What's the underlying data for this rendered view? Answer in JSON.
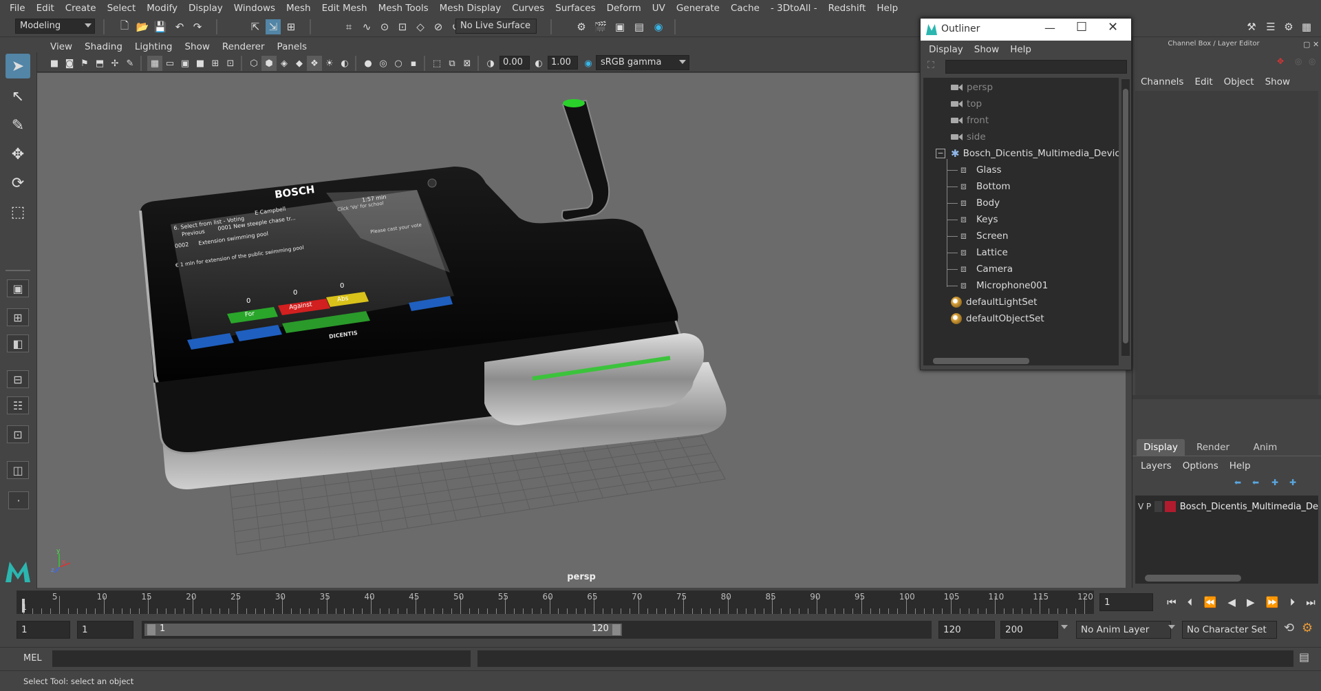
{
  "menubar": [
    "File",
    "Edit",
    "Create",
    "Select",
    "Modify",
    "Display",
    "Windows",
    "Mesh",
    "Edit Mesh",
    "Mesh Tools",
    "Mesh Display",
    "Curves",
    "Surfaces",
    "Deform",
    "UV",
    "Generate",
    "Cache",
    "- 3DtoAll -",
    "Redshift",
    "Help"
  ],
  "statusline": {
    "menuset": "Modeling",
    "live_surface": "No Live Surface"
  },
  "viewport": {
    "menus": [
      "View",
      "Shading",
      "Lighting",
      "Show",
      "Renderer",
      "Panels"
    ],
    "exposure": "0.00",
    "gamma": "1.00",
    "colorspace": "sRGB gamma",
    "camera_label": "persp",
    "axis": {
      "x": "x",
      "y": "y",
      "z": "z"
    },
    "device": {
      "brand": "BOSCH",
      "sub_brand": "DICENTIS",
      "screen_line1": "6. Select from list - Voting",
      "screen_name": "E Campbell",
      "screen_time": "1:57 min",
      "screen_prev": "Previous",
      "screen_item1": "0001 New steeple chase tr...",
      "screen_item2_no": "0002",
      "screen_item2": "Extension swimming pool",
      "screen_item3": "€ 1 mln for extension of the public swimming pool",
      "screen_vote_prompt": "Please cast your vote",
      "screen_click": "Click 'Vo' for school",
      "count_for": "0",
      "count_against": "0",
      "count_abs": "0",
      "btn_for": "For",
      "btn_against": "Against",
      "btn_abs": "Abs"
    }
  },
  "outliner": {
    "title": "Outliner",
    "menus": [
      "Display",
      "Show",
      "Help"
    ],
    "cameras": [
      "persp",
      "top",
      "front",
      "side"
    ],
    "group": "Bosch_Dicentis_Multimedia_Device",
    "children": [
      "Glass",
      "Bottom",
      "Body",
      "Keys",
      "Screen",
      "Lattice",
      "Camera",
      "Microphone001"
    ],
    "sets": [
      "defaultLightSet",
      "defaultObjectSet"
    ]
  },
  "channelbox": {
    "title": "Channel Box / Layer Editor",
    "menus": [
      "Channels",
      "Edit",
      "Object",
      "Show"
    ],
    "tabs": [
      "Display",
      "Render",
      "Anim"
    ],
    "layer_menus": [
      "Layers",
      "Options",
      "Help"
    ],
    "layer": {
      "v": "V",
      "p": "P",
      "name": "Bosch_Dicentis_Multimedia_De",
      "color": "#b01c2e"
    }
  },
  "timeline": {
    "ticks": [
      "5",
      "10",
      "15",
      "20",
      "25",
      "30",
      "35",
      "40",
      "45",
      "50",
      "55",
      "60",
      "65",
      "70",
      "75",
      "80",
      "85",
      "90",
      "95",
      "100",
      "105",
      "110",
      "115",
      "120"
    ],
    "current_marker": "1",
    "current_frame": "1",
    "range_start": "1",
    "playback_start": "1",
    "slider_start": "1",
    "slider_end": "120",
    "playback_end": "120",
    "range_end": "200",
    "anim_layer": "No Anim Layer",
    "character_set": "No Character Set"
  },
  "commandline": {
    "label": "MEL"
  },
  "helpline": {
    "text": "Select Tool: select an object"
  }
}
